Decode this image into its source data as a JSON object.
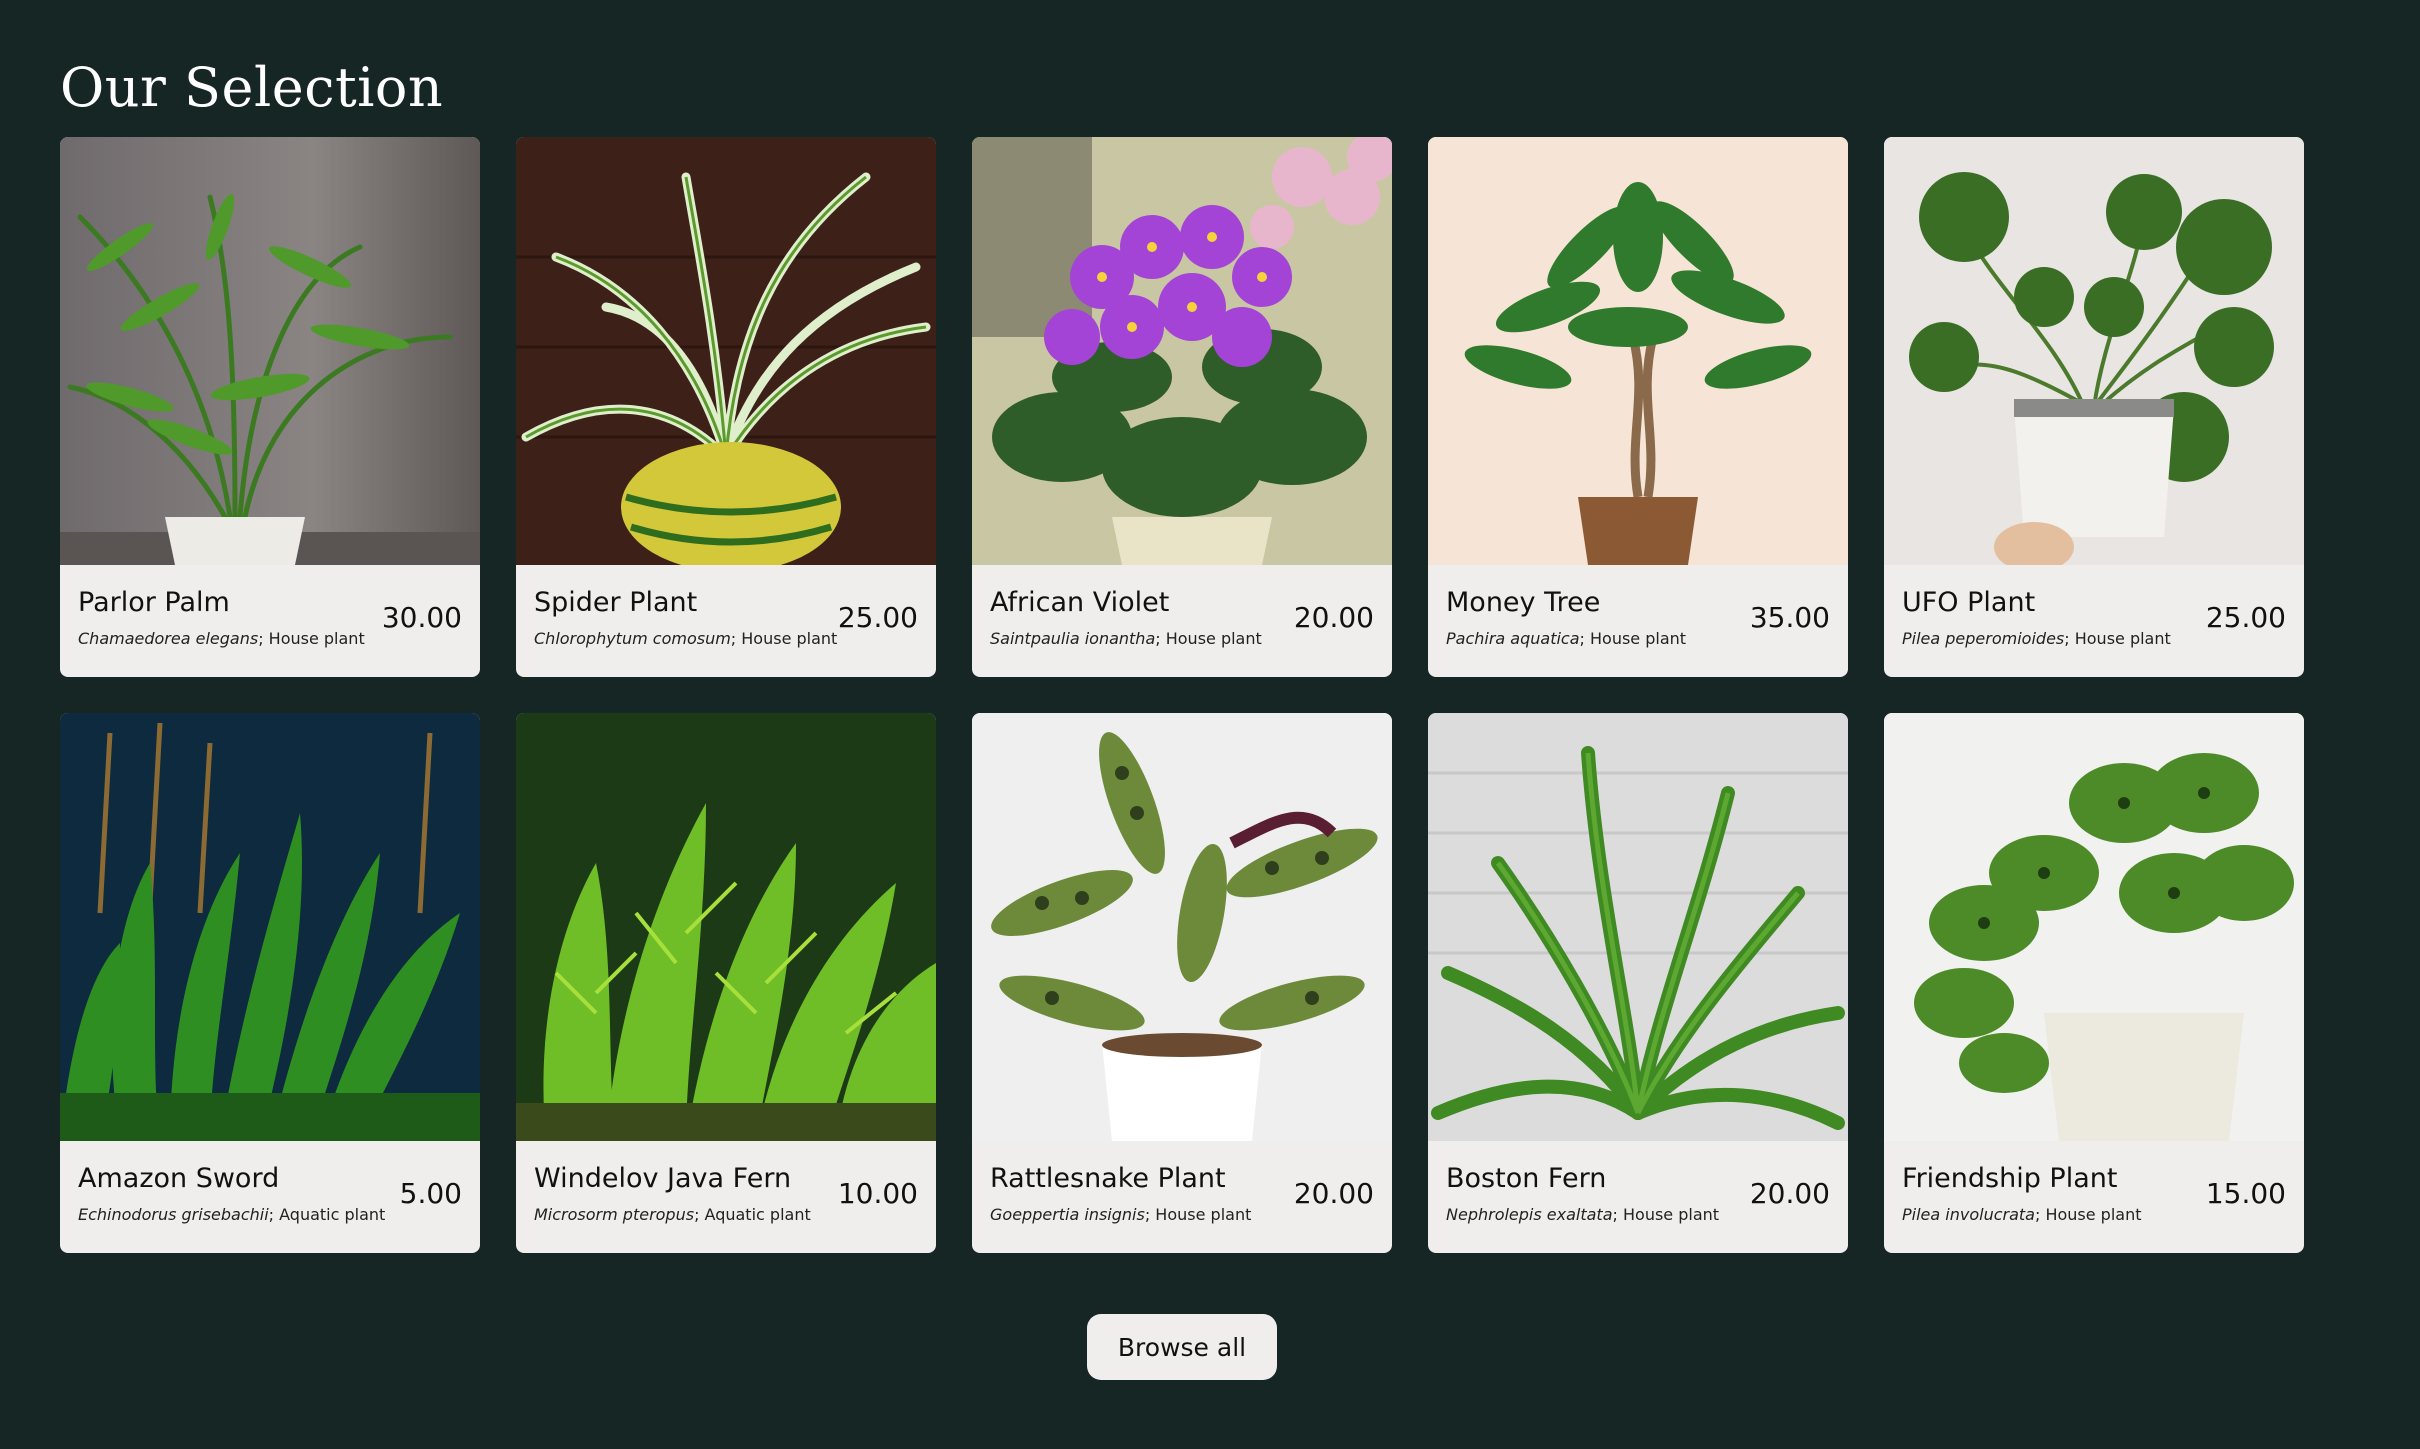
{
  "section": {
    "title": "Our Selection"
  },
  "products": [
    {
      "name": "Parlor Palm",
      "scientific": "Chamaedorea elegans",
      "category": "; House plant",
      "price": "30.00",
      "image": "parlor-palm-photo"
    },
    {
      "name": "Spider Plant",
      "scientific": "Chlorophytum comosum",
      "category": "; House plant",
      "price": "25.00",
      "image": "spider-plant-photo"
    },
    {
      "name": "African Violet",
      "scientific": "Saintpaulia ionantha",
      "category": "; House plant",
      "price": "20.00",
      "image": "african-violet-photo"
    },
    {
      "name": "Money Tree",
      "scientific": "Pachira aquatica",
      "category": "; House plant",
      "price": "35.00",
      "image": "money-tree-photo"
    },
    {
      "name": "UFO Plant",
      "scientific": "Pilea peperomioides",
      "category": "; House plant",
      "price": "25.00",
      "image": "ufo-plant-photo"
    },
    {
      "name": "Amazon Sword",
      "scientific": "Echinodorus grisebachii",
      "category": "; Aquatic plant",
      "price": "5.00",
      "image": "amazon-sword-photo"
    },
    {
      "name": "Windelov Java Fern",
      "scientific": "Microsorm pteropus",
      "category": "; Aquatic plant",
      "price": "10.00",
      "image": "java-fern-photo"
    },
    {
      "name": "Rattlesnake Plant",
      "scientific": "Goeppertia insignis",
      "category": "; House plant",
      "price": "20.00",
      "image": "rattlesnake-plant-photo"
    },
    {
      "name": "Boston Fern",
      "scientific": "Nephrolepis exaltata",
      "category": "; House plant",
      "price": "20.00",
      "image": "boston-fern-photo"
    },
    {
      "name": "Friendship Plant",
      "scientific": "Pilea involucrata",
      "category": "; House plant",
      "price": "15.00",
      "image": "friendship-plant-photo"
    }
  ],
  "actions": {
    "browse_all": "Browse all"
  },
  "colors": {
    "background": "#152625",
    "card": "#f0eded",
    "title": "#ffffff"
  }
}
